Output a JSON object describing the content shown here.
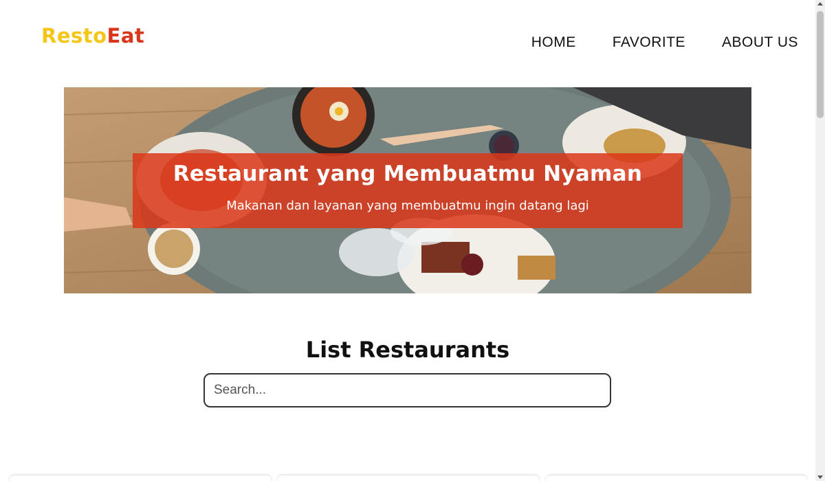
{
  "brand": {
    "logo_part1": "Resto",
    "logo_part2": "Eat",
    "color_yellow": "#f5c518",
    "color_red": "#d9361b"
  },
  "nav": {
    "items": [
      {
        "label": "HOME"
      },
      {
        "label": "FAVORITE"
      },
      {
        "label": "ABOUT US"
      }
    ]
  },
  "hero": {
    "title": "Restaurant yang Membuatmu Nyaman",
    "subtitle": "Makanan dan layanan yang membuatmu ingin datang lagi",
    "image": "restaurant-table-food-photo",
    "overlay_color": "#db3719"
  },
  "restaurants": {
    "heading": "List Restaurants",
    "search_placeholder": "Search..."
  }
}
